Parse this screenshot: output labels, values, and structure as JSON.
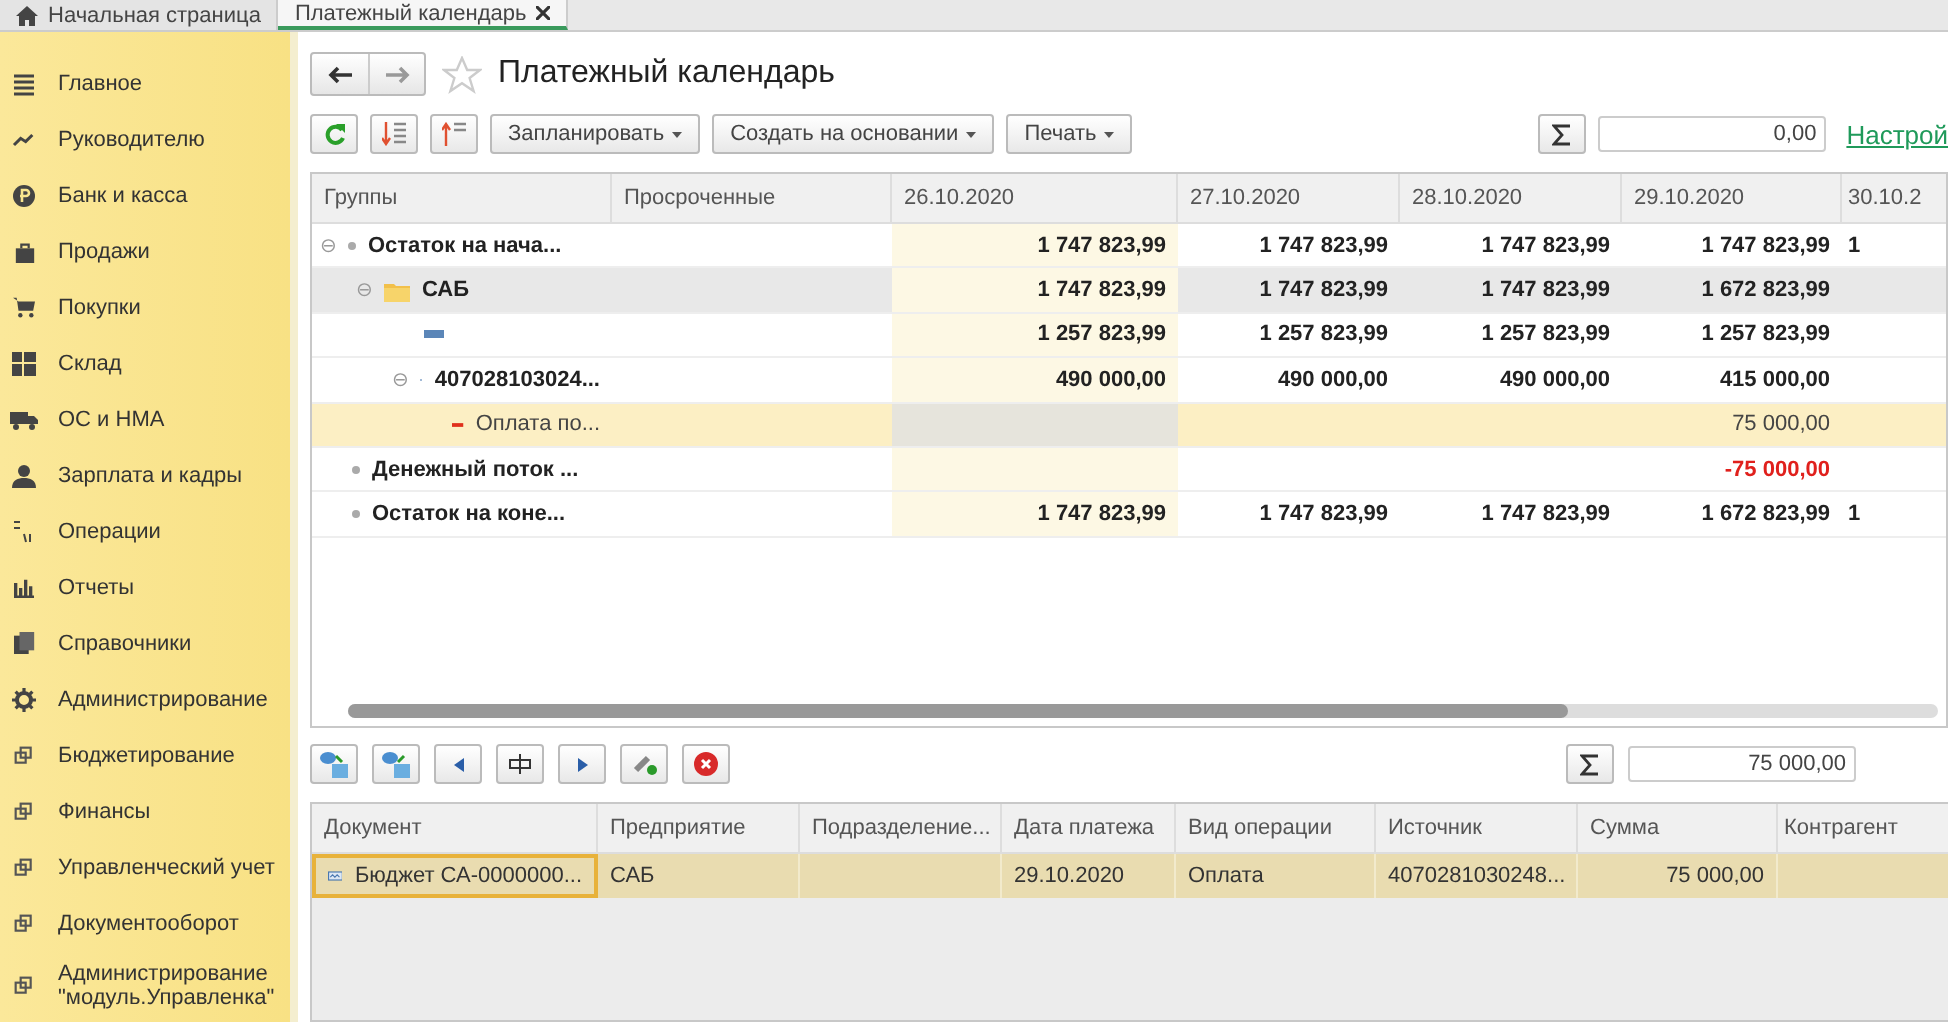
{
  "tabs": [
    {
      "label": "Начальная страница",
      "selected": false,
      "home": true
    },
    {
      "label": "Платежный календарь",
      "selected": true,
      "closable": true
    }
  ],
  "sidebar": {
    "items": [
      {
        "label": "Главное"
      },
      {
        "label": "Руководителю"
      },
      {
        "label": "Банк и касса"
      },
      {
        "label": "Продажи"
      },
      {
        "label": "Покупки"
      },
      {
        "label": "Склад"
      },
      {
        "label": "ОС и НМА"
      },
      {
        "label": "Зарплата и кадры"
      },
      {
        "label": "Операции"
      },
      {
        "label": "Отчеты"
      },
      {
        "label": "Справочники"
      },
      {
        "label": "Администрирование"
      },
      {
        "label": "Бюджетирование"
      },
      {
        "label": "Финансы"
      },
      {
        "label": "Управленческий учет"
      },
      {
        "label": "Документооборот"
      },
      {
        "label": "Администрирование \"модуль.Управленка\""
      }
    ]
  },
  "title": "Платежный календарь",
  "toolbar": {
    "buttons": [
      "Запланировать",
      "Создать на основании",
      "Печать"
    ],
    "sum": "0,00",
    "link": "Настрой"
  },
  "table": {
    "columns": [
      {
        "label": "Группы"
      },
      {
        "label": "Просроченные"
      },
      {
        "label": "26.10.2020",
        "highlighted": true
      },
      {
        "label": "27.10.2020"
      },
      {
        "label": "28.10.2020"
      },
      {
        "label": "29.10.2020"
      },
      {
        "label": "30.10.2"
      }
    ],
    "rows": [
      {
        "label": "Остаток на нача...",
        "kind": "total",
        "toggle": "⊖",
        "selected": false,
        "values": {
          "column_3": "1 747 823,99",
          "column_4": "1 747 823,99",
          "column_5": "1 747 823,99",
          "column_6": "1 747 823,99",
          "column_7": "1"
        },
        "children": [
          {
            "label": "САБ",
            "kind": "folder",
            "toggle": "⊖",
            "selected": false,
            "values": {
              "column_3": "1 747 823,99",
              "column_4": "1 747 823,99",
              "column_5": "1 747 823,99",
              "column_6": "1 672 823,99"
            },
            "children": [
              {
                "kind": "account",
                "selected": false,
                "values": {
                  "column_3": "1 257 823,99",
                  "column_4": "1 257 823,99",
                  "column_5": "1 257 823,99",
                  "column_6": "1 257 823,99"
                }
              },
              {
                "label": "407028103024...",
                "kind": "account",
                "toggle": "⊖",
                "selected": false,
                "values": {
                  "column_3": "490 000,00",
                  "column_4": "490 000,00",
                  "column_5": "490 000,00",
                  "column_6": "415 000,00"
                },
                "children": [
                  {
                    "label": "Оплата по...",
                    "kind": "expense",
                    "selected": true,
                    "values": {
                      "column_6": "75 000,00"
                    }
                  }
                ]
              }
            ]
          }
        ]
      },
      {
        "label": "Денежный поток ...",
        "kind": "total",
        "selected": false,
        "negative": true,
        "values": {
          "column_6": "-75 000,00"
        }
      },
      {
        "label": "Остаток на коне...",
        "kind": "total",
        "selected": false,
        "values": {
          "column_3": "1 747 823,99",
          "column_4": "1 747 823,99",
          "column_5": "1 747 823,99",
          "column_6": "1 672 823,99",
          "column_7": "1"
        }
      }
    ]
  },
  "details": {
    "sum": "75 000,00",
    "columns": [
      "Документ",
      "Предприятие",
      "Подразделение...",
      "Дата платежа",
      "Вид операции",
      "Источник",
      "Сумма",
      "Контрагент"
    ],
    "rows": [
      {
        "selected": true,
        "cells": {
          "column_1": "Бюджет СА-0000000...",
          "column_2": "САБ",
          "column_4": "29.10.2020",
          "column_5": "Оплата",
          "column_6": "4070281030248...",
          "column_7": "75 000,00"
        }
      }
    ]
  }
}
